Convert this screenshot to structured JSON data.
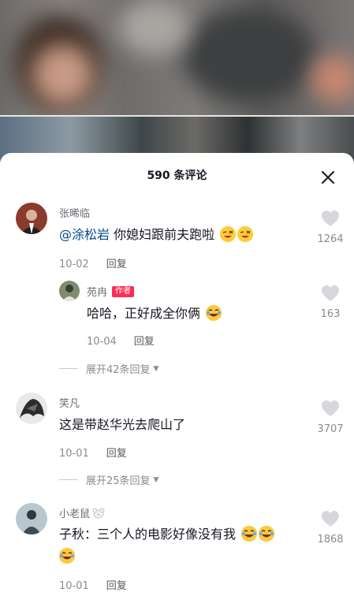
{
  "header": {
    "comment_count_title": "590 条评论"
  },
  "comments": [
    {
      "user": "张晞临",
      "mention": "@涂松岩",
      "text": " 你媳妇跟前夫跑啦",
      "emojis": [
        "wink",
        "wink"
      ],
      "date": "10-02",
      "reply_label": "回复",
      "likes": "1264",
      "reply": {
        "user": "苑冉",
        "badge": "作者",
        "text": "哈哈，正好成全你俩",
        "emojis": [
          "laugh"
        ],
        "date": "10-04",
        "reply_label": "回复",
        "likes": "163"
      },
      "expand_label": "展开42条回复"
    },
    {
      "user": "笑凡",
      "text": "这是带赵华光去爬山了",
      "date": "10-01",
      "reply_label": "回复",
      "likes": "3707",
      "expand_label": "展开25条回复"
    },
    {
      "user": "小老鼠",
      "text": "子秋：三个人的电影好像没有我",
      "emojis": [
        "laugh",
        "laugh",
        "laugh"
      ],
      "date": "10-01",
      "reply_label": "回复",
      "likes": "1868"
    }
  ],
  "colors": {
    "mention": "#04498d",
    "author_badge": "#fe2c55",
    "muted": "#8a8b91"
  },
  "icons": {
    "close": "close-icon",
    "like": "heart-icon",
    "expand": "caret-down-icon"
  }
}
